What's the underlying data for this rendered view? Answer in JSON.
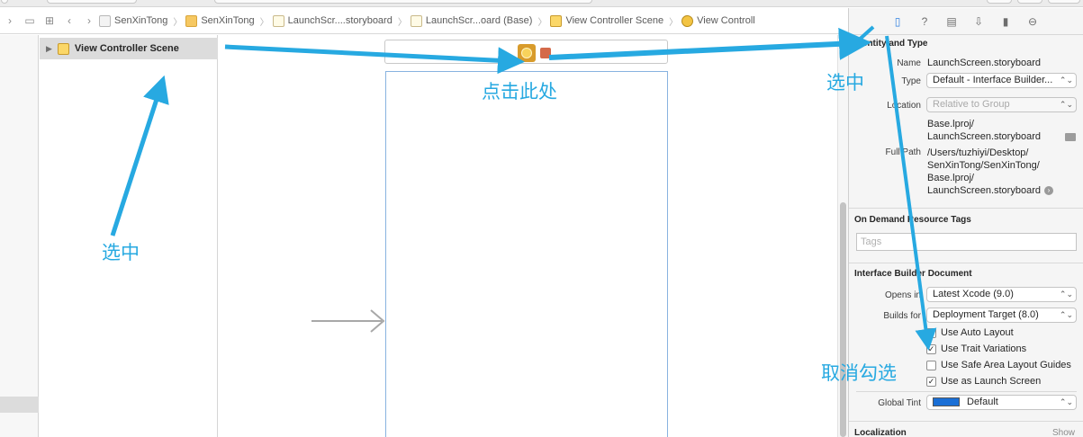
{
  "jumpbar": {
    "icons": [
      "related-files-icon",
      "back-arrow-icon",
      "forward-arrow-icon"
    ],
    "breadcrumbs": [
      {
        "label": "SenXinTong",
        "icon": "project-icon"
      },
      {
        "label": "SenXinTong",
        "icon": "folder-icon"
      },
      {
        "label": "LaunchScr....storyboard",
        "icon": "storyboard-file-icon"
      },
      {
        "label": "LaunchScr...oard (Base)",
        "icon": "storyboard-file-icon"
      },
      {
        "label": "View Controller Scene",
        "icon": "scene-icon"
      },
      {
        "label": "View Controll",
        "icon": "view-controller-icon"
      }
    ]
  },
  "outline": {
    "scene_label": "View Controller Scene"
  },
  "inspector": {
    "tabs": [
      "file-inspector-icon",
      "quick-help-icon",
      "identity-inspector-icon",
      "attributes-inspector-icon",
      "size-inspector-icon",
      "connections-inspector-icon"
    ],
    "identity": {
      "title": "Identity and Type",
      "name_label": "Name",
      "name_value": "LaunchScreen.storyboard",
      "type_label": "Type",
      "type_value": "Default - Interface Builder...",
      "location_label": "Location",
      "location_value": "Relative to Group",
      "location_path_1": "Base.lproj/",
      "location_path_2": "LaunchScreen.storyboard",
      "fullpath_label": "Full Path",
      "fullpath_1": "/Users/tuzhiyi/Desktop/",
      "fullpath_2": "SenXinTong/SenXinTong/",
      "fullpath_3": "Base.lproj/",
      "fullpath_4": "LaunchScreen.storyboard"
    },
    "tags": {
      "title": "On Demand Resource Tags",
      "placeholder": "Tags"
    },
    "ibdoc": {
      "title": "Interface Builder Document",
      "opens_in_label": "Opens in",
      "opens_in_value": "Latest Xcode (9.0)",
      "builds_for_label": "Builds for",
      "builds_for_value": "Deployment Target (8.0)",
      "checkboxes": [
        {
          "label": "Use Auto Layout",
          "checked": true
        },
        {
          "label": "Use Trait Variations",
          "checked": true
        },
        {
          "label": "Use Safe Area Layout Guides",
          "checked": false
        },
        {
          "label": "Use as Launch Screen",
          "checked": true
        }
      ],
      "global_tint_label": "Global Tint",
      "global_tint_value": "Default",
      "global_tint_color": "#1a6fd6"
    },
    "localization": {
      "title": "Localization",
      "show_label": "Show"
    }
  },
  "annotations": {
    "select_outline": "选中",
    "click_here": "点击此处",
    "select_inspector": "选中",
    "uncheck": "取消勾选",
    "color": "#27a9e1"
  }
}
